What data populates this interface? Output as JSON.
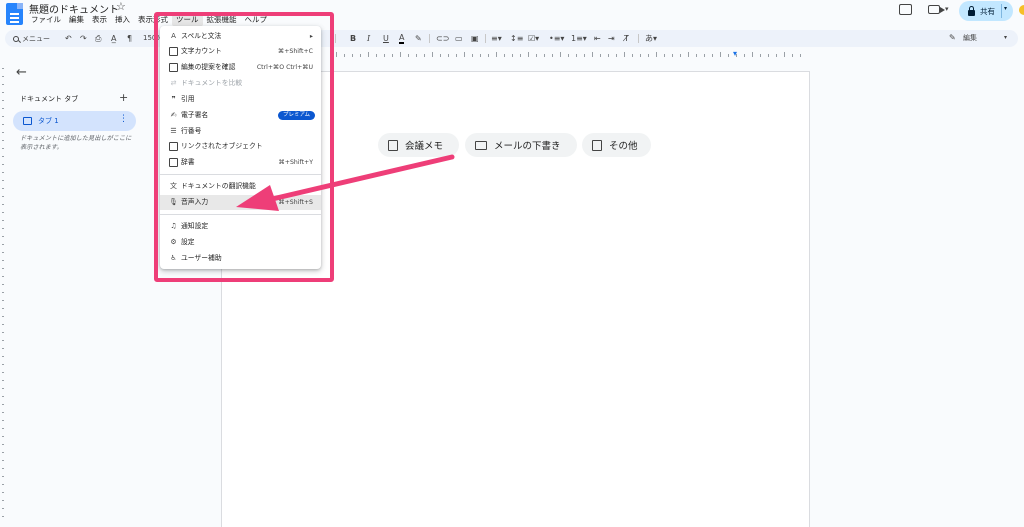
{
  "header": {
    "doc_title": "無題のドキュメント",
    "menus": [
      "ファイル",
      "編集",
      "表示",
      "挿入",
      "表示形式",
      "ツール",
      "拡張機能",
      "ヘルプ"
    ],
    "active_menu": "ツール",
    "share_label": "共有"
  },
  "toolbar": {
    "menu_search": "メニュー",
    "zoom": "150%",
    "edit_mode": "編集"
  },
  "side_panel": {
    "header": "ドキュメント タブ",
    "tab_label": "タブ 1",
    "hint": "ドキュメントに追加した見出しがここに表示されます。"
  },
  "chips": {
    "notes": "会議メモ",
    "email": "メールの下書き",
    "more": "その他"
  },
  "tools_menu": {
    "items": [
      {
        "label": "スペルと文法",
        "shortcut": "▸",
        "icon": "spellcheck-icon"
      },
      {
        "label": "文字カウント",
        "shortcut": "⌘+Shift+C",
        "icon": "word-count-icon"
      },
      {
        "label": "編集の提案を確認",
        "shortcut": "Ctrl+⌘O Ctrl+⌘U",
        "icon": "review-edits-icon"
      },
      {
        "label": "ドキュメントを比較",
        "shortcut": "",
        "icon": "compare-icon"
      },
      {
        "label": "引用",
        "shortcut": "",
        "icon": "citation-icon"
      },
      {
        "label": "電子署名",
        "shortcut": "",
        "icon": "signature-icon",
        "badge": "プレミアム"
      },
      {
        "label": "行番号",
        "shortcut": "",
        "icon": "line-numbers-icon"
      },
      {
        "label": "リンクされたオブジェクト",
        "shortcut": "",
        "icon": "linked-objects-icon"
      },
      {
        "label": "辞書",
        "shortcut": "⌘+Shift+Y",
        "icon": "dictionary-icon"
      },
      {
        "label": "ドキュメントの翻訳機能",
        "shortcut": "",
        "icon": "translate-icon"
      },
      {
        "label": "音声入力",
        "shortcut": "⌘+Shift+S",
        "icon": "microphone-icon"
      },
      {
        "label": "通知設定",
        "shortcut": "",
        "icon": "bell-icon"
      },
      {
        "label": "設定",
        "shortcut": "",
        "icon": "settings-icon"
      },
      {
        "label": "ユーザー補助",
        "shortcut": "",
        "icon": "accessibility-icon"
      }
    ]
  },
  "colors": {
    "annotation": "#ee3e78",
    "share_bg": "#c2e7ff",
    "tab_active_bg": "#d3e3fd",
    "premium_badge": "#0b57d0"
  }
}
